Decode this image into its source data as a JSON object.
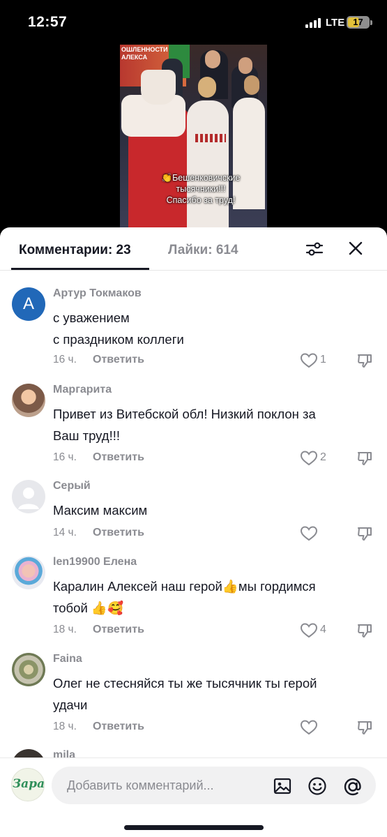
{
  "status_bar": {
    "time": "12:57",
    "network": "LTE",
    "battery": "17"
  },
  "video": {
    "banner_text": "ОШЛЕННОСТИ\nАЛЕКСА",
    "caption_line1": "👏Бешенковичские",
    "caption_line2": "тысячники!!!",
    "caption_line3": "Спасибо за труд!"
  },
  "tabs": {
    "comments_label": "Комментарии: 23",
    "likes_label": "Лайки: 614"
  },
  "comments": [
    {
      "username": "Артур Токмаков",
      "avatar_letter": "A",
      "line1": "с уважением",
      "line2": "с праздником коллеги",
      "time": "16 ч.",
      "reply": "Ответить",
      "likes": "1"
    },
    {
      "username": "Маргарита",
      "line1": "Привет из Витебской обл! Низкий поклон за",
      "line2": "Ваш труд!!!",
      "time": "16 ч.",
      "reply": "Ответить",
      "likes": "2"
    },
    {
      "username": "Серый",
      "line1": "Максим максим",
      "time": "14 ч.",
      "reply": "Ответить",
      "likes": ""
    },
    {
      "username": "len19900 Елена",
      "line1": "Каралин Алексей наш герой👍мы гордимся",
      "line2": "тобой 👍🥰",
      "time": "18 ч.",
      "reply": "Ответить",
      "likes": "4"
    },
    {
      "username": "Faina",
      "line1": "Олег не стесняйся ты же тысячник ты герой",
      "line2": "удачи",
      "time": "18 ч.",
      "reply": "Ответить",
      "likes": ""
    },
    {
      "username": "mila"
    }
  ],
  "input": {
    "avatar_text": "Зара",
    "placeholder": "Добавить комментарий..."
  }
}
